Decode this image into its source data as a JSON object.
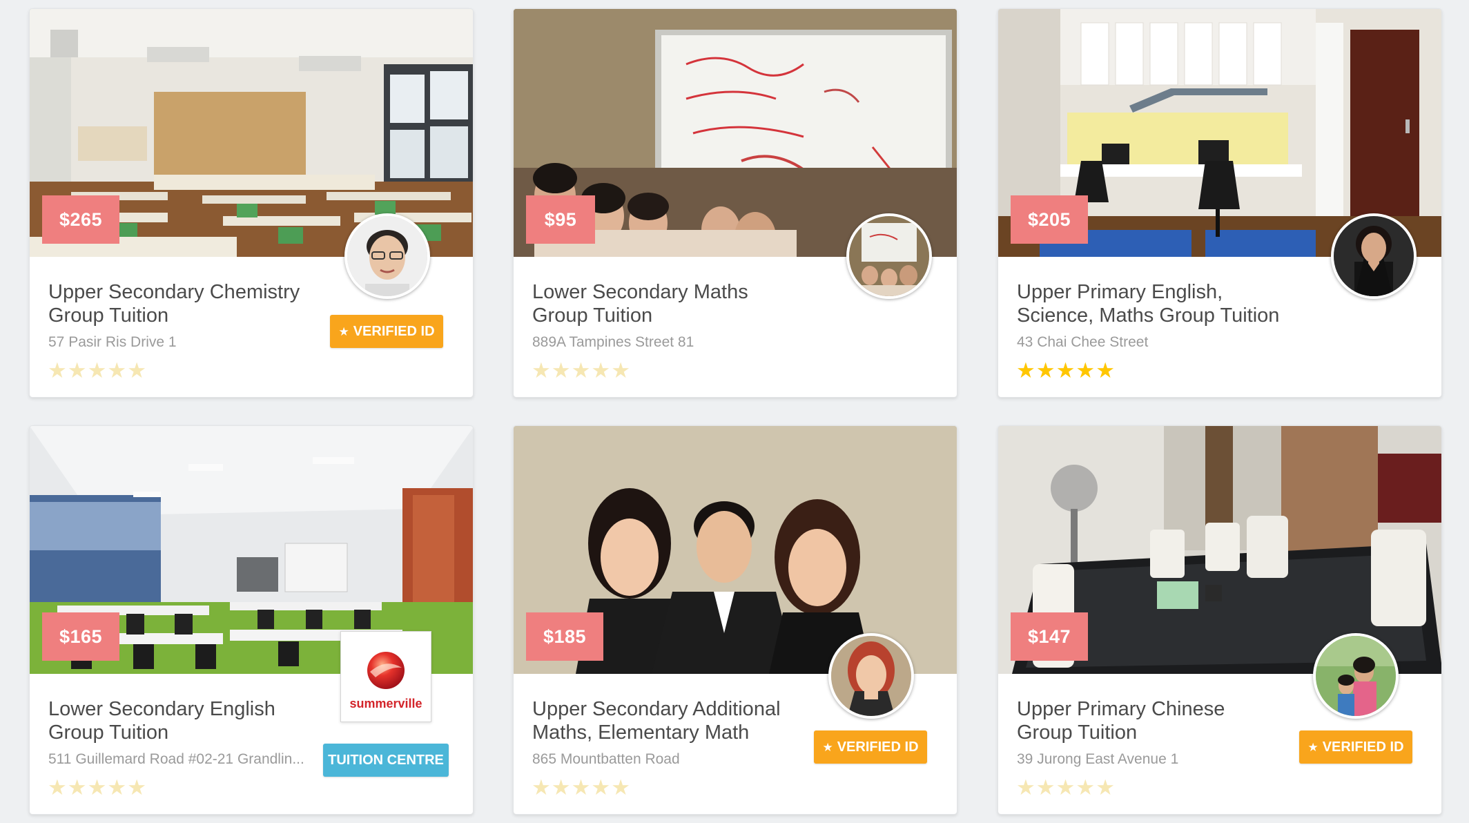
{
  "cards": [
    {
      "price": "$265",
      "title_line1": "Upper Secondary Chemistry",
      "title_line2": "Group Tuition",
      "address": "57 Pasir Ris Drive 1",
      "badge": "VERIFIED ID",
      "rating": 0
    },
    {
      "price": "$95",
      "title_line1": "Lower Secondary Maths",
      "title_line2": "Group Tuition",
      "address": "889A Tampines Street 81",
      "rating": 0
    },
    {
      "price": "$205",
      "title_line1": "Upper Primary English,",
      "title_line2": "Science, Maths Group Tuition",
      "address": "43 Chai Chee Street",
      "rating": 5
    },
    {
      "price": "$165",
      "title_line1": "Lower Secondary English",
      "title_line2": "Group Tuition",
      "address": "511 Guillemard Road #02-21 Grandlin...",
      "badge": "TUITION CENTRE",
      "logo_text": "summerville",
      "rating": 0
    },
    {
      "price": "$185",
      "title_line1": "Upper Secondary Additional",
      "title_line2": "Maths, Elementary Math",
      "address": "865 Mountbatten Road",
      "badge": "VERIFIED ID",
      "rating": 0
    },
    {
      "price": "$147",
      "title_line1": "Upper Primary Chinese",
      "title_line2": "Group Tuition",
      "address": "39 Jurong East Avenue 1",
      "badge": "VERIFIED ID",
      "rating": 0
    }
  ],
  "colors": {
    "price_tag": "#ef7f7f",
    "verified_badge": "#f9a51c",
    "centre_badge": "#4bb6d8",
    "star_filled": "#ffc600",
    "star_empty": "#f6e7b3"
  },
  "icons": {
    "star": "★"
  }
}
